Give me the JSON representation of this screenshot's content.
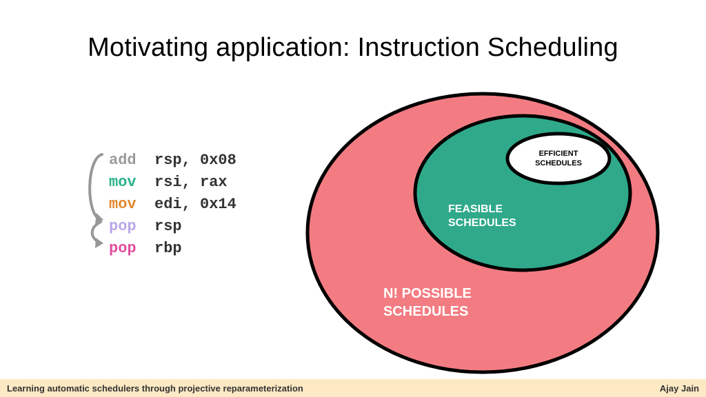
{
  "title": "Motivating application: Instruction Scheduling",
  "code": {
    "lines": [
      {
        "mn": "add",
        "mn_class": "mn-gray",
        "ops": "rsp, 0x08"
      },
      {
        "mn": "mov",
        "mn_class": "mn-teal",
        "ops": "rsi, rax"
      },
      {
        "mn": "mov",
        "mn_class": "mn-orange",
        "ops": "edi, 0x14"
      },
      {
        "mn": "pop",
        "mn_class": "mn-lav",
        "ops": "rsp"
      },
      {
        "mn": "pop",
        "mn_class": "mn-pink",
        "ops": "rbp"
      }
    ]
  },
  "venn": {
    "outer": "N! POSSIBLE SCHEDULES",
    "outer_l1": "N! POSSIBLE",
    "outer_l2": "SCHEDULES",
    "middle": "FEASIBLE SCHEDULES",
    "middle_l1": "FEASIBLE",
    "middle_l2": "SCHEDULES",
    "inner": "EFFICIENT SCHEDULES",
    "inner_l1": "EFFICIENT",
    "inner_l2": "SCHEDULES",
    "colors": {
      "outer": "#f37c82",
      "middle": "#2fa98a",
      "inner": "#ffffff",
      "stroke": "#000000"
    }
  },
  "footer": {
    "left": "Learning automatic schedulers through projective reparameterization",
    "right": "Ajay Jain"
  }
}
